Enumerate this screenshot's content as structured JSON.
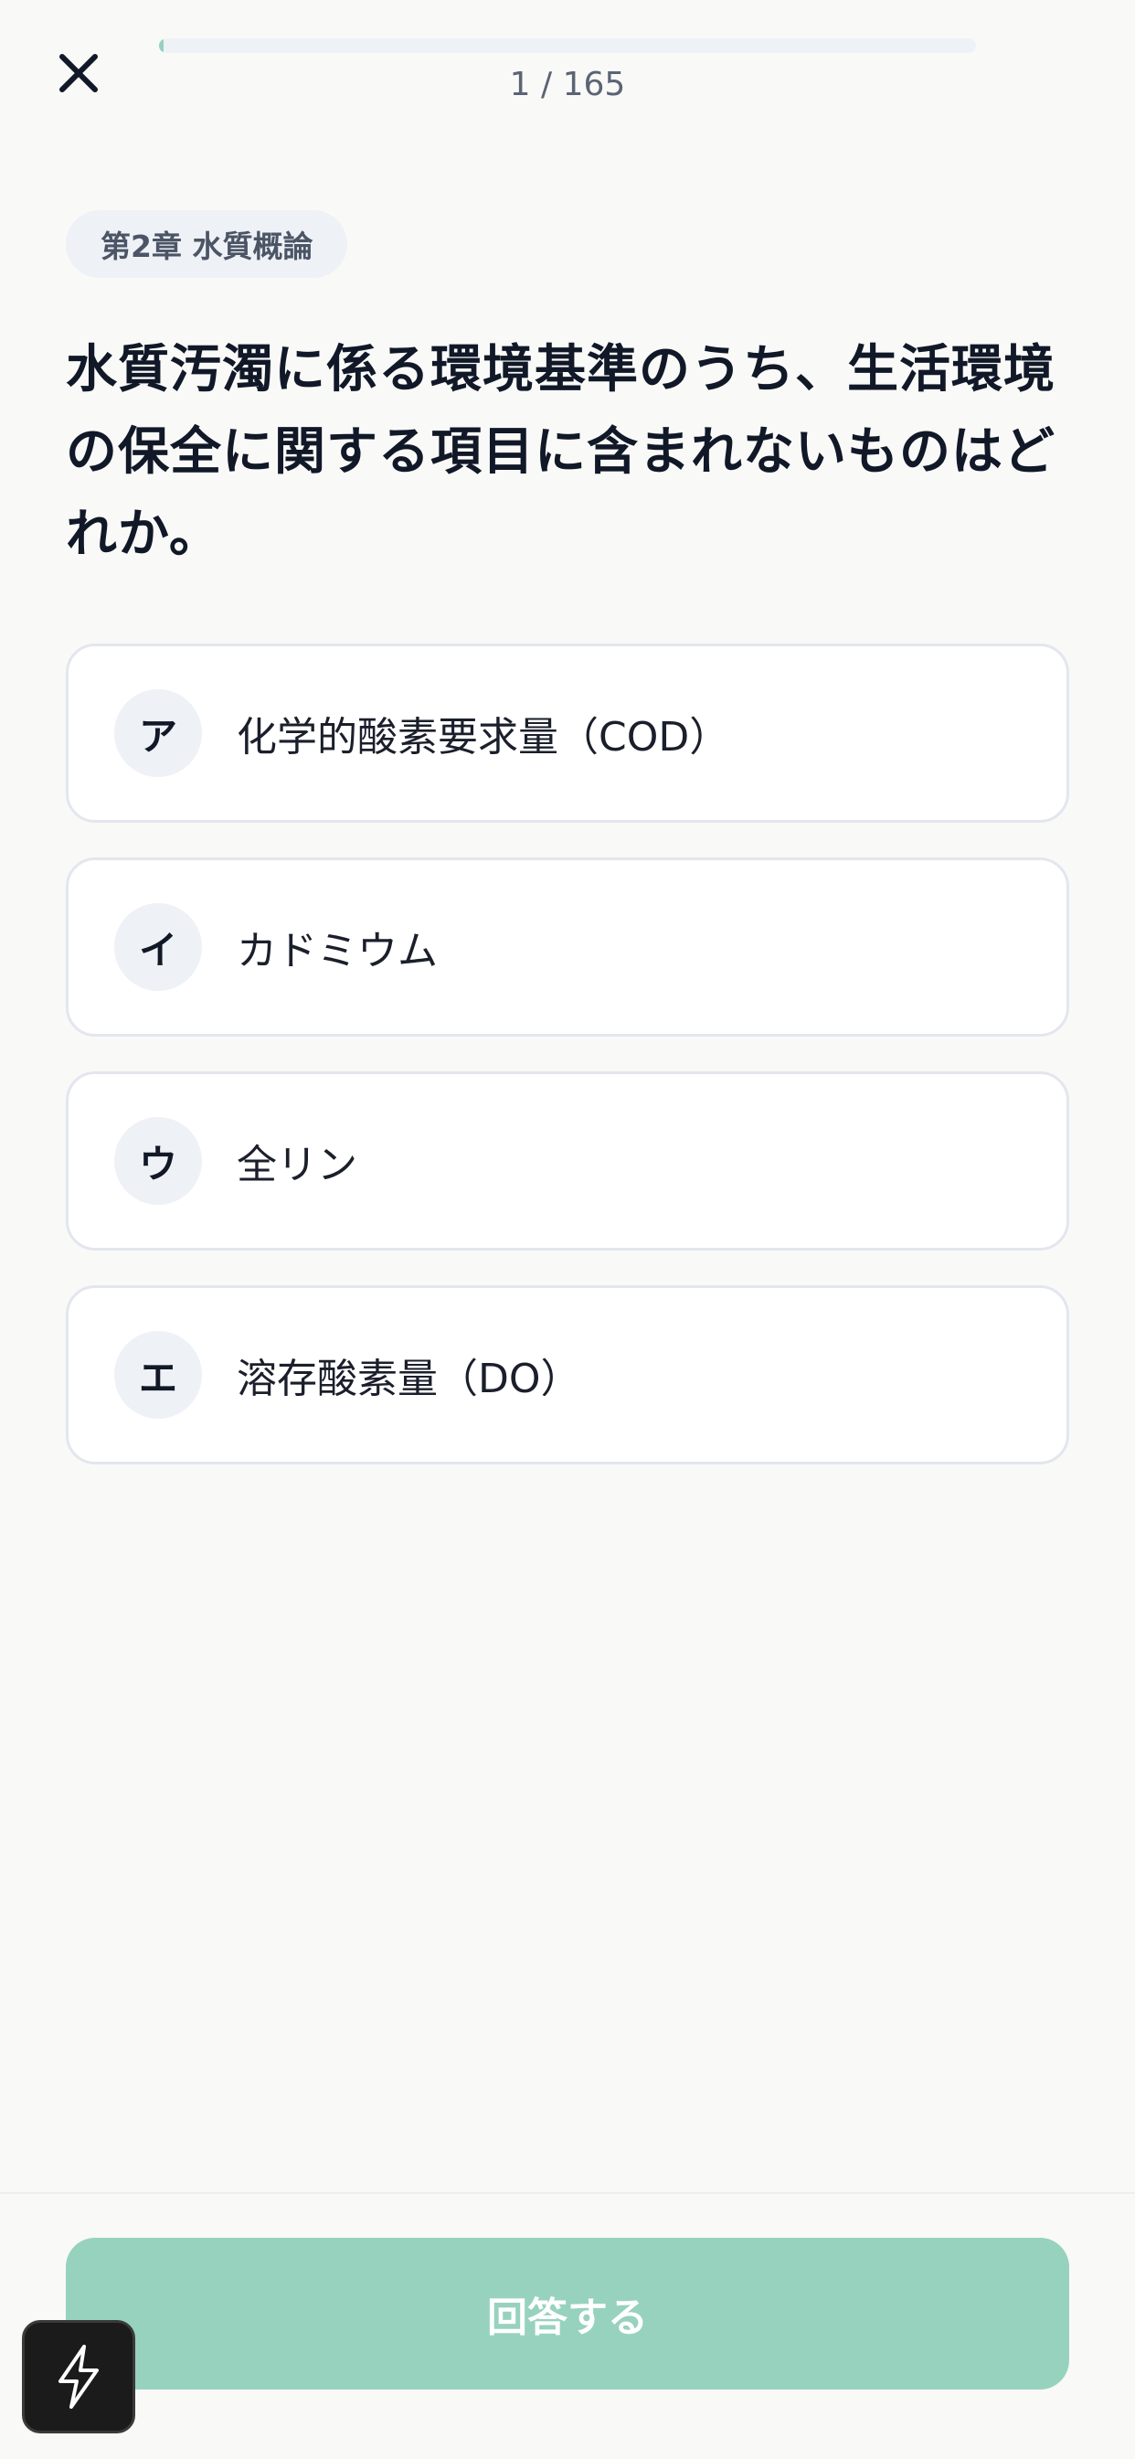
{
  "header": {
    "close_icon": "close-icon",
    "progress": {
      "current": 1,
      "total": 165,
      "text": "1 / 165",
      "fraction": 0.006
    }
  },
  "chapter": {
    "label": "第2章 水質概論"
  },
  "question": {
    "text": "水質汚濁に係る環境基準のうち、生活環境の保全に関する項目に含まれないものはどれか。"
  },
  "choices": [
    {
      "key": "ア",
      "label": "化学的酸素要求量（COD）"
    },
    {
      "key": "イ",
      "label": "カドミウム"
    },
    {
      "key": "ウ",
      "label": "全リン"
    },
    {
      "key": "エ",
      "label": "溶存酸素量（DO）"
    }
  ],
  "footer": {
    "answer_label": "回答する",
    "flash_icon": "lightning-icon"
  },
  "colors": {
    "accent": "#97d2bf",
    "background": "#f9f9f8",
    "pill_bg": "#eef1f6"
  }
}
